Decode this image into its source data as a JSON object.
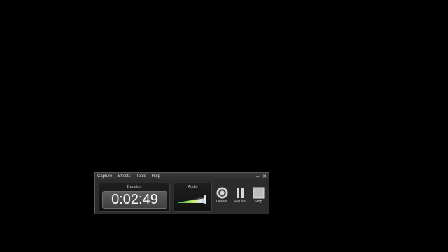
{
  "menu": {
    "items": [
      {
        "label": "Capture"
      },
      {
        "label": "Effects"
      },
      {
        "label": "Tools"
      },
      {
        "label": "Help"
      }
    ]
  },
  "window": {
    "minimize": "–",
    "close": "✕"
  },
  "duration": {
    "label": "Duration",
    "value": "0:02:49"
  },
  "audio": {
    "label": "Audio"
  },
  "controls": {
    "delete": {
      "label": "Delete",
      "icon": "refresh-delete-icon"
    },
    "pause": {
      "label": "Pause",
      "icon": "pause-icon"
    },
    "stop": {
      "label": "Stop",
      "icon": "stop-icon"
    }
  }
}
